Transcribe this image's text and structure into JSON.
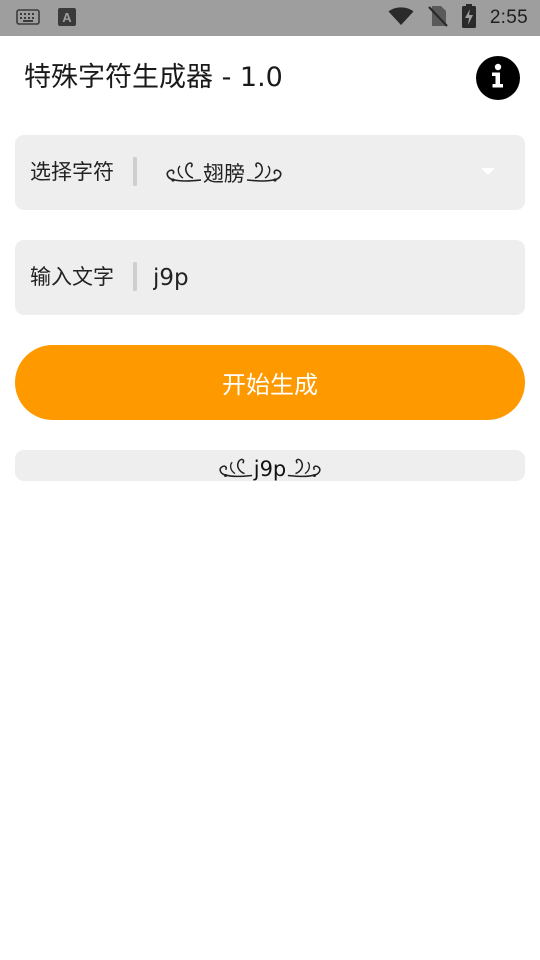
{
  "status_bar": {
    "time": "2:55",
    "icons": [
      "keyboard-icon",
      "a-notification-icon",
      "wifi-icon",
      "no-sim-icon",
      "battery-charging-icon"
    ],
    "badge_letter": "A"
  },
  "header": {
    "title": "特殊字符生成器 - 1.0",
    "info_icon": "info-icon"
  },
  "select_field": {
    "label": "选择字符",
    "value_text": "翅膀",
    "decoration": "wing-flourish",
    "dropdown_icon": "dropdown-arrow-icon"
  },
  "input_field": {
    "label": "输入文字",
    "value": "j9p",
    "placeholder": ""
  },
  "start_button": {
    "label": "开始生成"
  },
  "result": {
    "text": "j9p",
    "decoration": "wing-flourish"
  },
  "colors": {
    "status_bar_bg": "#9e9e9e",
    "accent": "#ff9900",
    "card_bg": "#eeeeee",
    "info_button_bg": "#000000"
  }
}
